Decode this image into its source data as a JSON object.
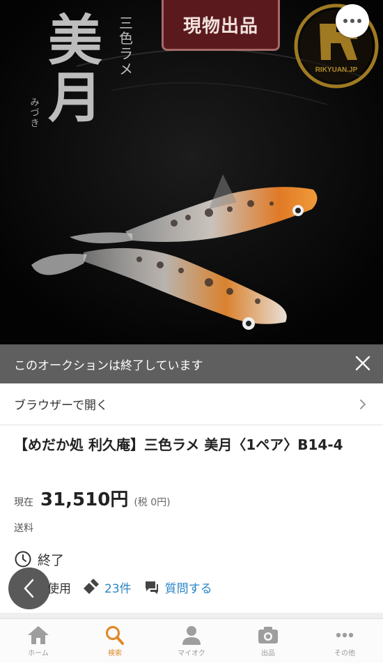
{
  "hero": {
    "title_series": "三色ラメ",
    "title_main": "美月",
    "title_reading": "みづき",
    "badge": "現物出品",
    "logo_text": "RIKYUAN.JP"
  },
  "banner": {
    "message": "このオークションは終了しています"
  },
  "browser": {
    "label": "ブラウザーで開く"
  },
  "item": {
    "title": "【めだか処 利久庵】三色ラメ 美月〈1ペア〉B14-4",
    "price_label": "現在",
    "price_value": "31,510円",
    "price_tax": "(税 0円)",
    "shipping_label": "送料",
    "status": "終了",
    "meta_partial": "使用",
    "bids": "23件",
    "question": "質問する"
  },
  "tabs": [
    {
      "label": "ホーム",
      "icon": "home-icon"
    },
    {
      "label": "検索",
      "icon": "search-icon"
    },
    {
      "label": "マイオク",
      "icon": "person-icon"
    },
    {
      "label": "出品",
      "icon": "camera-icon"
    },
    {
      "label": "その他",
      "icon": "more-icon"
    }
  ],
  "colors": {
    "accent": "#e08a2b",
    "link": "#2a85c7",
    "banner": "#5f5f5f"
  }
}
